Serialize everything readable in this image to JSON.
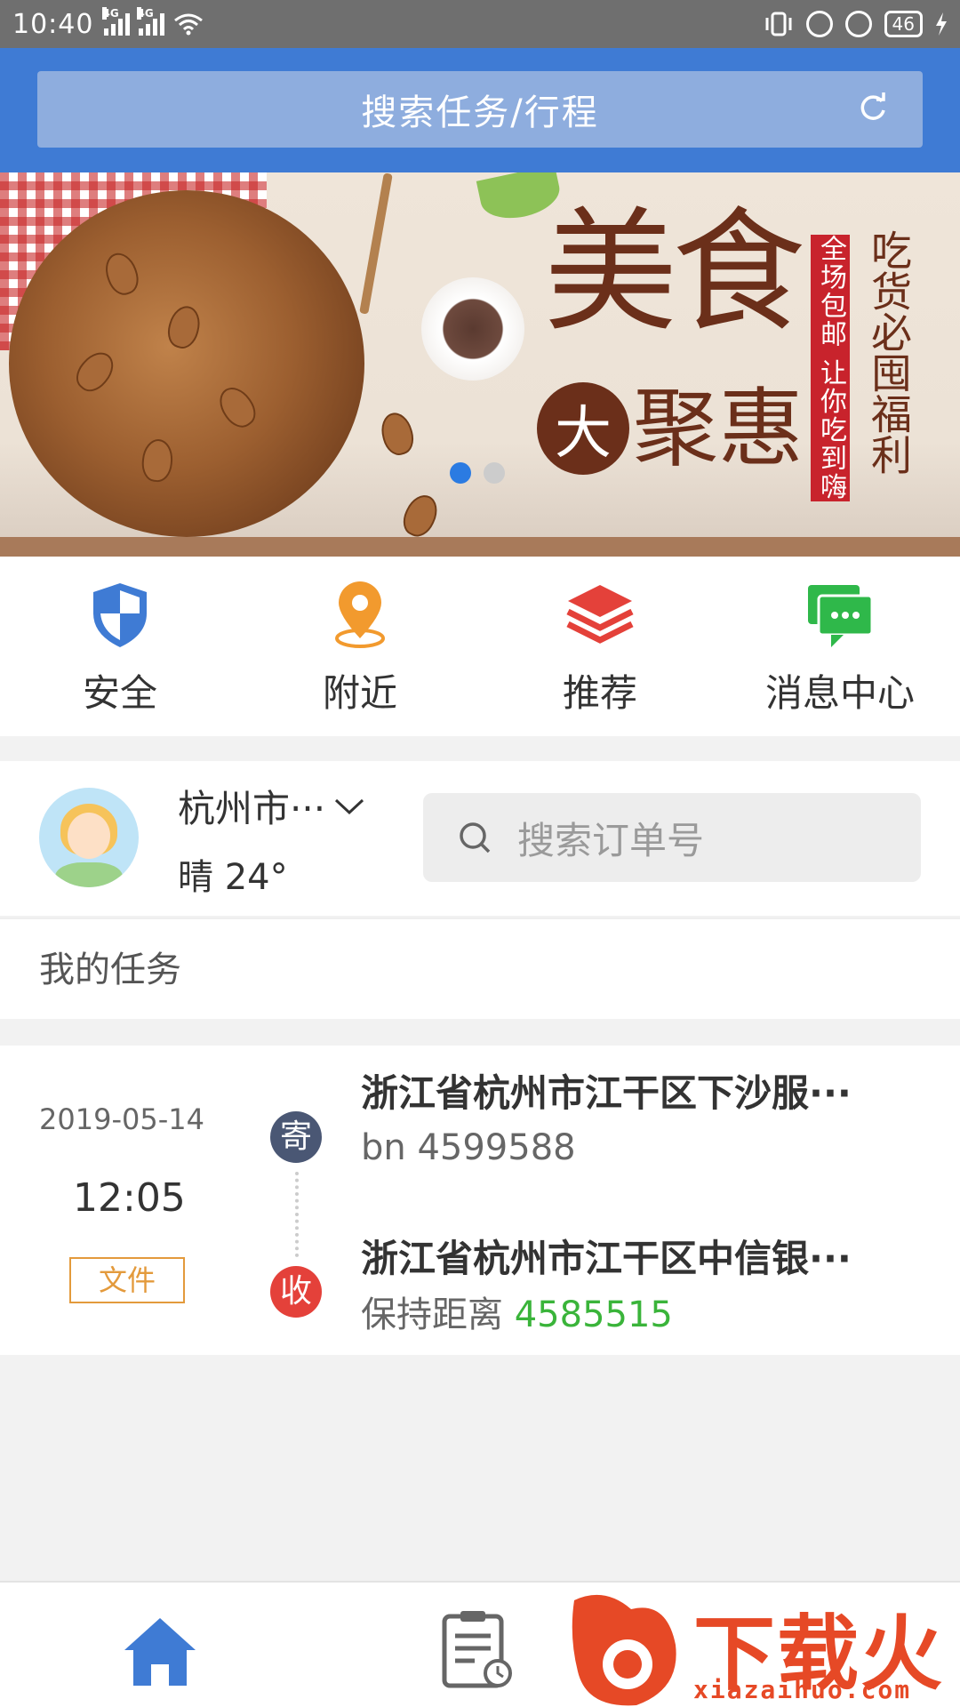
{
  "status_bar": {
    "time": "10:40",
    "network_1": "4G",
    "network_2": "4G",
    "battery": "46"
  },
  "header": {
    "search_placeholder": "搜索任务/行程"
  },
  "banner": {
    "headline_1": "美食",
    "headline_circle": "大",
    "headline_2": "聚惠",
    "vertical_red": "全场包邮 让你吃到嗨",
    "vertical_brown": "吃货必囤福利",
    "dot_count": 2,
    "active_dot": 0
  },
  "quick_actions": [
    {
      "label": "安全",
      "icon": "shield-icon",
      "color": "#3f7bd4"
    },
    {
      "label": "附近",
      "icon": "location-pin-icon",
      "color": "#f29a2e"
    },
    {
      "label": "推荐",
      "icon": "layers-icon",
      "color": "#e4413a"
    },
    {
      "label": "消息中心",
      "icon": "chat-icon",
      "color": "#2fb84a"
    }
  ],
  "location": {
    "city": "杭州市···",
    "weather": "晴 24°"
  },
  "order_search": {
    "placeholder": "搜索订单号"
  },
  "section": {
    "title": "我的任务"
  },
  "task": {
    "date": "2019-05-14",
    "time": "12:05",
    "tag": "文件",
    "send_badge": "寄",
    "recv_badge": "收",
    "from_address": "浙江省杭州市江干区下沙服···",
    "from_contact": "bn 4599588",
    "to_address": "浙江省杭州市江干区中信银···",
    "to_name": "保持距离",
    "to_phone": "4585515"
  },
  "bottom_nav": {
    "items": [
      {
        "icon": "home-icon",
        "active": true
      },
      {
        "icon": "task-list-icon",
        "active": false
      }
    ]
  },
  "watermark": {
    "text": "下载火",
    "url": "xiazaihuo.com"
  },
  "colors": {
    "primary": "#3f7bd4",
    "accent_orange": "#f29a2e",
    "accent_red": "#e4413a",
    "accent_green": "#2fb84a"
  }
}
